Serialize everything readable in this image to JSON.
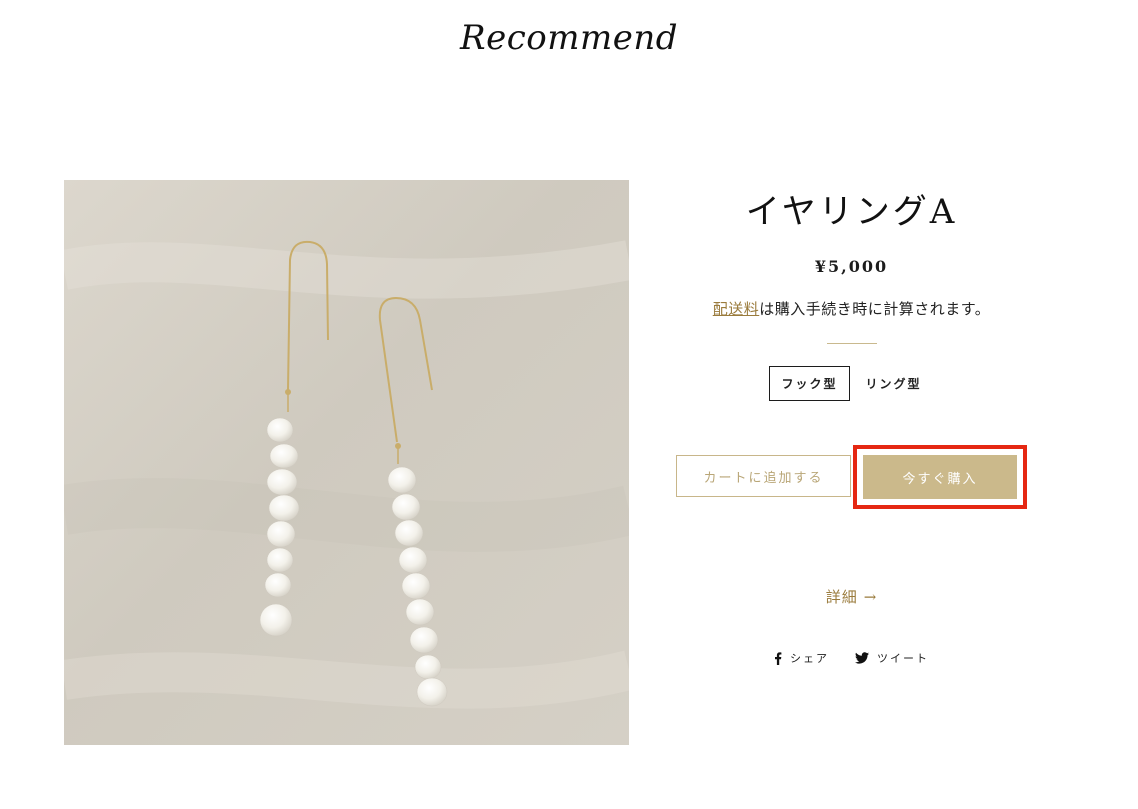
{
  "section": {
    "title": "Recommend"
  },
  "product": {
    "title": "イヤリングA",
    "price": "¥5,000",
    "shipping_link": "配送料",
    "shipping_text": "は購入手続き時に計算されます。",
    "variants": [
      "フック型",
      "リング型"
    ],
    "selected_variant": "フック型",
    "add_to_cart_label": "カートに追加する",
    "buy_now_label": "今すぐ購入",
    "details_label": "詳細",
    "details_arrow": "→"
  },
  "share": {
    "facebook_label": "シェア",
    "twitter_label": "ツイート",
    "facebook_icon": "facebook-icon",
    "twitter_icon": "twitter-icon"
  },
  "colors": {
    "accent": "#cbb98b",
    "link": "#9a7b3c",
    "highlight_border": "#e52712"
  }
}
